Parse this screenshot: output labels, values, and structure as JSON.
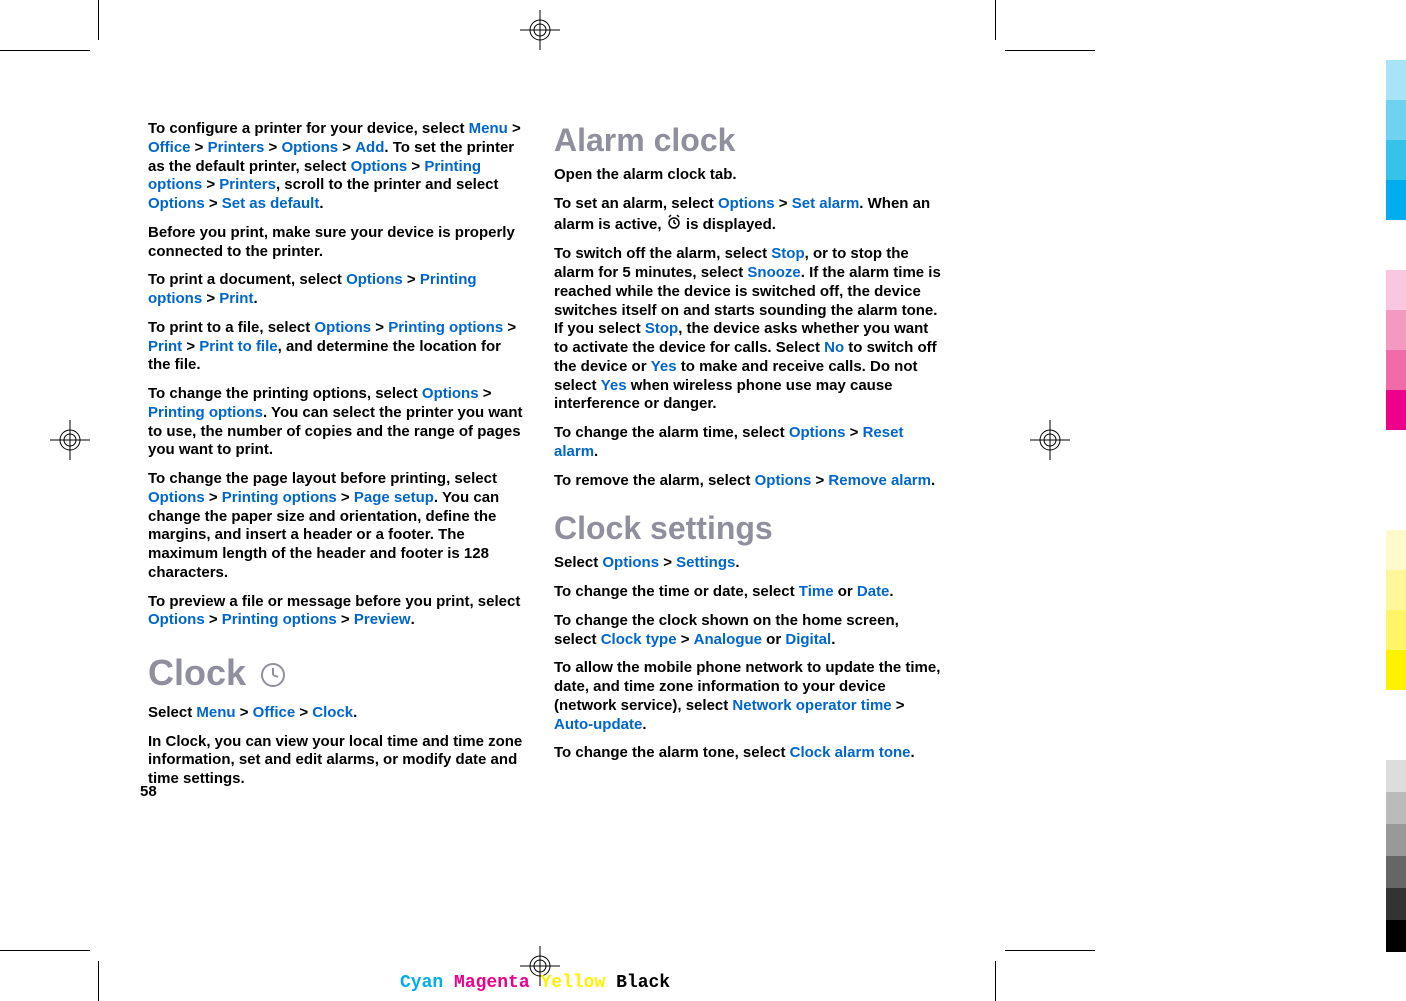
{
  "page_number": "58",
  "left_column": {
    "para1_parts": [
      "To configure a printer for your device, select ",
      "Menu",
      " > ",
      "Office",
      " > ",
      "Printers",
      " > ",
      "Options",
      " > ",
      "Add",
      ". To set the printer as the default printer, select ",
      "Options",
      " > ",
      "Printing options",
      " > ",
      "Printers",
      ", scroll to the printer and select ",
      "Options",
      " > ",
      "Set as default",
      "."
    ],
    "para2": "Before you print, make sure your device is properly connected to the printer.",
    "para3_parts": [
      "To print a document, select ",
      "Options",
      " > ",
      "Printing options",
      " > ",
      "Print",
      "."
    ],
    "para4_parts": [
      "To print to a file, select ",
      "Options",
      " > ",
      "Printing options",
      " > ",
      "Print",
      " > ",
      "Print to file",
      ", and determine the location for the file."
    ],
    "para5_parts": [
      "To change the printing options, select ",
      "Options",
      " > ",
      "Printing options",
      ". You can select the printer you want to use, the number of copies and the range of pages you want to print."
    ],
    "para6_parts": [
      "To change the page layout before printing, select ",
      "Options",
      " > ",
      "Printing options",
      " > ",
      "Page setup",
      ". You can change the paper size and orientation, define the margins, and insert a header or a footer. The maximum length of the header and footer is 128 characters."
    ],
    "para7_parts": [
      "To preview a file or message before you print, select ",
      "Options",
      " > ",
      "Printing options",
      " > ",
      "Preview",
      "."
    ],
    "clock_heading": "Clock",
    "para8_parts": [
      "Select ",
      "Menu",
      " > ",
      "Office",
      " > ",
      "Clock",
      "."
    ],
    "para9": "In Clock, you can view your local time and time zone information, set and edit alarms, or modify date and time settings."
  },
  "right_column": {
    "alarm_heading": "Alarm clock",
    "para1": "Open the alarm clock tab.",
    "para2_parts": [
      "To set an alarm, select ",
      "Options",
      " > ",
      "Set alarm",
      ". When an alarm is active, "
    ],
    "para2_suffix": " is displayed.",
    "para3_parts": [
      "To switch off the alarm, select ",
      "Stop",
      ", or to stop the alarm for 5 minutes, select ",
      "Snooze",
      ". If the alarm time is reached while the device is switched off, the device switches itself on and starts sounding the alarm tone. If you select ",
      "Stop",
      ", the device asks whether you want to activate the device for calls. Select ",
      "No",
      " to switch off the device or ",
      "Yes",
      " to make and receive calls. Do not select ",
      "Yes",
      " when wireless phone use may cause interference or danger."
    ],
    "para4_parts": [
      "To change the alarm time, select ",
      "Options",
      " > ",
      "Reset alarm",
      "."
    ],
    "para5_parts": [
      "To remove the alarm, select ",
      "Options",
      " > ",
      "Remove alarm",
      "."
    ],
    "clock_settings_heading": "Clock settings",
    "para6_parts": [
      "Select ",
      "Options",
      " > ",
      "Settings",
      "."
    ],
    "para7_parts": [
      "To change the time or date, select ",
      "Time",
      " or ",
      "Date",
      "."
    ],
    "para8_parts": [
      "To change the clock shown on the home screen, select ",
      "Clock type",
      " > ",
      "Analogue",
      " or ",
      "Digital",
      "."
    ],
    "para9_parts": [
      "To allow the mobile phone network to update the time, date, and time zone information to your device (network service), select ",
      "Network operator time",
      " > ",
      "Auto-update",
      "."
    ],
    "para10_parts": [
      "To change the alarm tone, select ",
      "Clock alarm tone",
      "."
    ]
  },
  "cmyk": {
    "cyan": "Cyan",
    "magenta": "Magenta",
    "yellow": "Yellow",
    "black": "Black"
  }
}
